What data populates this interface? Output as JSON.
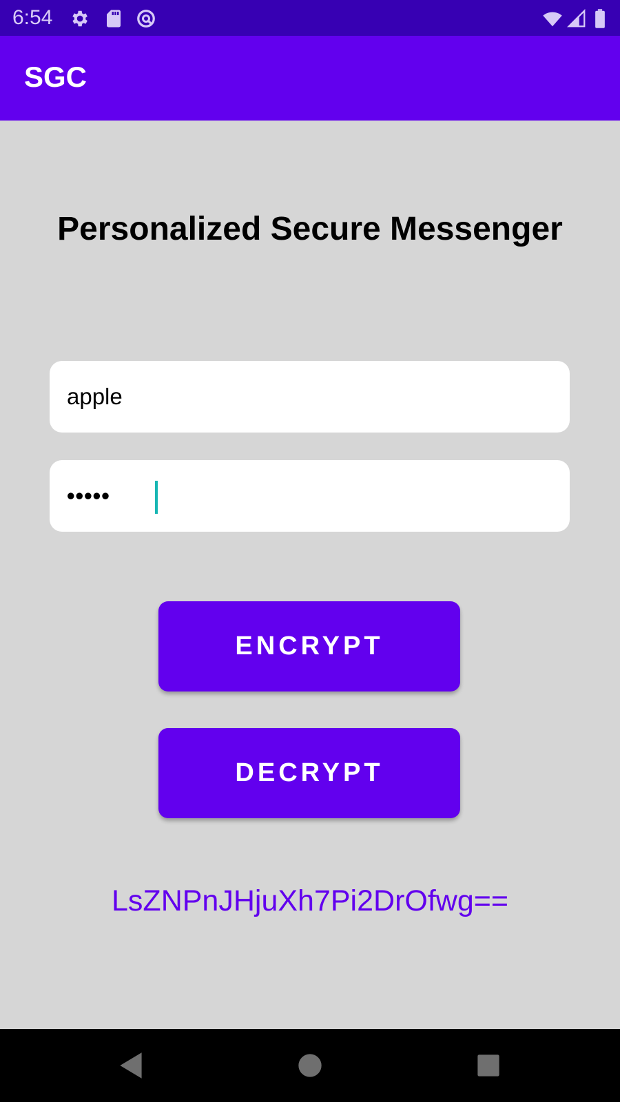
{
  "status_bar": {
    "time": "6:54",
    "icons": [
      "gear-icon",
      "sd-card-icon",
      "at-sign-icon",
      "wifi-icon",
      "signal-icon",
      "battery-icon"
    ]
  },
  "app_bar": {
    "title": "SGC"
  },
  "main": {
    "heading": "Personalized Secure Messenger",
    "message_field": {
      "value": "apple"
    },
    "key_field": {
      "value": "•••••"
    },
    "encrypt_label": "ENCRYPT",
    "decrypt_label": "DECRYPT",
    "result_text": "LsZNPnJHjuXh7Pi2DrOfwg=="
  },
  "nav_bar": {
    "buttons": [
      "back-icon",
      "home-icon",
      "recents-icon"
    ]
  },
  "colors": {
    "status_bar": "#3700b3",
    "primary": "#6200ee",
    "background": "#d6d6d6",
    "cursor": "#17b6b3"
  }
}
